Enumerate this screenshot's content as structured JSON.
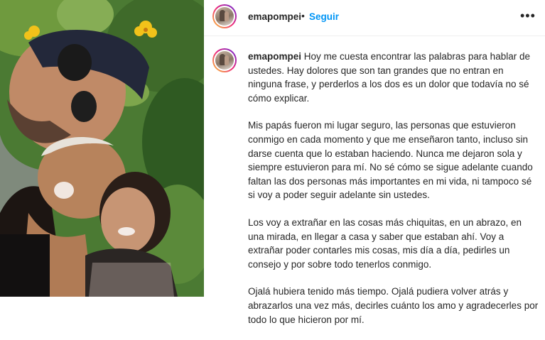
{
  "post": {
    "username": "emapompei",
    "separator": "•",
    "follow_label": "Seguir",
    "more_icon": "more-options-icon",
    "photo_alt": "Selfie de tres personas sonriendo frente a plantas con flores amarillas"
  },
  "caption": {
    "username": "emapompei",
    "p1": "Hoy me cuesta encontrar las palabras para hablar de ustedes. Hay dolores que son tan grandes que no entran en ninguna frase, y perderlos a los dos es un dolor que todavía no sé cómo explicar.",
    "p2": "Mis papás fueron mi lugar seguro, las personas que estuvieron conmigo en cada momento y que me enseñaron tanto, incluso sin darse cuenta que lo estaban haciendo. Nunca me dejaron sola y siempre estuvieron para mí. No sé cómo se sigue adelante cuando faltan las dos personas más importantes en mi vida, ni tampoco sé si voy a poder seguir adelante sin ustedes.",
    "p3": "Los voy a extrañar en las cosas más chiquitas, en un abrazo, en una mirada, en llegar a casa y saber que estaban ahí. Voy a extrañar poder contarles mis cosas, mis día a día, pedirles un consejo y por sobre todo tenerlos conmigo.",
    "p4": "Ojalá hubiera tenido más tiempo. Ojalá pudiera volver atrás y abrazarlos una vez más, decirles cuánto los amo y agradecerles por todo lo que hicieron por mí."
  },
  "colors": {
    "link": "#0095f6",
    "text": "#262626",
    "divider": "#efefef"
  }
}
